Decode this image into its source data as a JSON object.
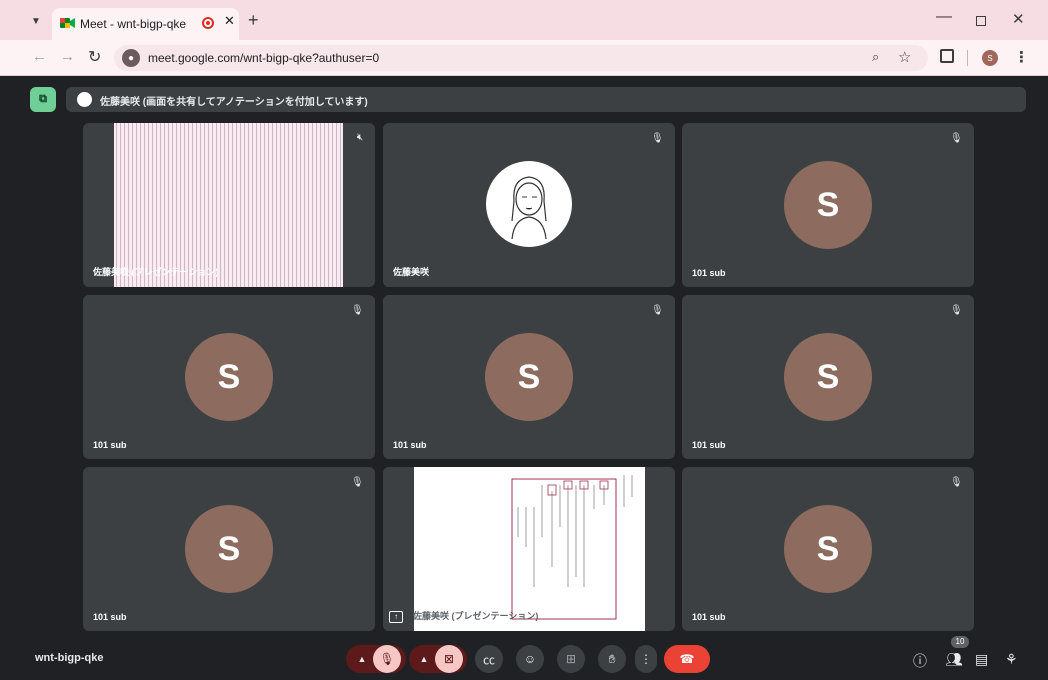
{
  "browser": {
    "tab_title": "Meet - wnt-bigp-qke",
    "new_tab": "+",
    "url": "meet.google.com/wnt-bigp-qke?authuser=0",
    "profile_initial": "S"
  },
  "meet": {
    "presenting_banner": "佐藤美咲 (画面を共有してアノテーションを付加しています)",
    "meeting_code": "wnt-bigp-qke",
    "participant_count": "10",
    "avatar_initial": "S"
  },
  "tiles": [
    {
      "name": "佐藤美咲 (プレゼンテーション)",
      "type": "presentation-dense",
      "muted": true
    },
    {
      "name": "佐藤美咲",
      "type": "photo",
      "muted": true
    },
    {
      "name": "101 sub",
      "type": "avatar",
      "muted": true
    },
    {
      "name": "101 sub",
      "type": "avatar",
      "muted": true
    },
    {
      "name": "101 sub",
      "type": "avatar",
      "muted": true
    },
    {
      "name": "101 sub",
      "type": "avatar",
      "muted": true
    },
    {
      "name": "101 sub",
      "type": "avatar",
      "muted": true
    },
    {
      "name": "佐藤美咲 (プレゼンテーション)",
      "type": "presentation-doc",
      "muted": false
    },
    {
      "name": "101 sub",
      "type": "avatar",
      "muted": true
    }
  ],
  "colors": {
    "background": "#202124",
    "tile": "#3c4043",
    "avatar": "#8d6c5f",
    "end_call": "#ea4335",
    "muted_control": "#5c1a1a",
    "tab_strip": "#f6dde3"
  },
  "controls": [
    "chevron-up-icon",
    "mic-off-icon",
    "chevron-up-icon",
    "camera-off-icon",
    "captions-icon",
    "emoji-icon",
    "present-icon",
    "hand-icon",
    "more-icon",
    "end-call-icon"
  ]
}
